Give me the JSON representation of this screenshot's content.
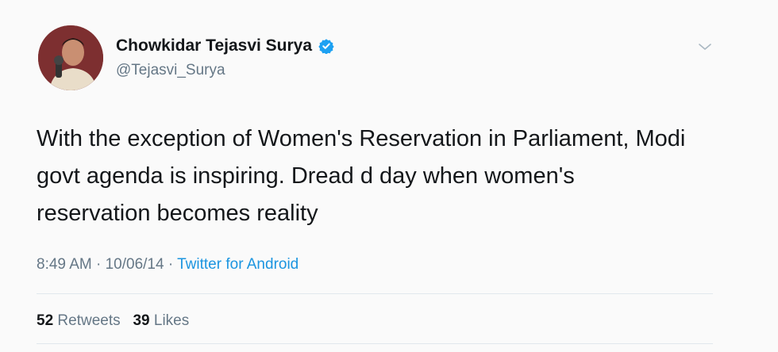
{
  "tweet": {
    "author": {
      "display_name": "Chowkidar Tejasvi Surya",
      "handle": "@Tejasvi_Surya",
      "verified": true,
      "avatar_icon": "profile-avatar"
    },
    "text": "With the exception of Women's Reservation in Parliament, Modi\ngovt agenda is inspiring. Dread d day when women's\nreservation becomes reality",
    "time": "8:49 AM",
    "separator": " · ",
    "date": "10/06/14",
    "source": "Twitter for Android",
    "stats": {
      "retweets_count": "52",
      "retweets_label": "Retweets",
      "likes_count": "39",
      "likes_label": "Likes"
    },
    "menu_icon": "chevron-down-icon"
  },
  "colors": {
    "text_primary": "#14171a",
    "text_secondary": "#657786",
    "link": "#1b95e0",
    "verified_badge": "#1da1f2"
  }
}
